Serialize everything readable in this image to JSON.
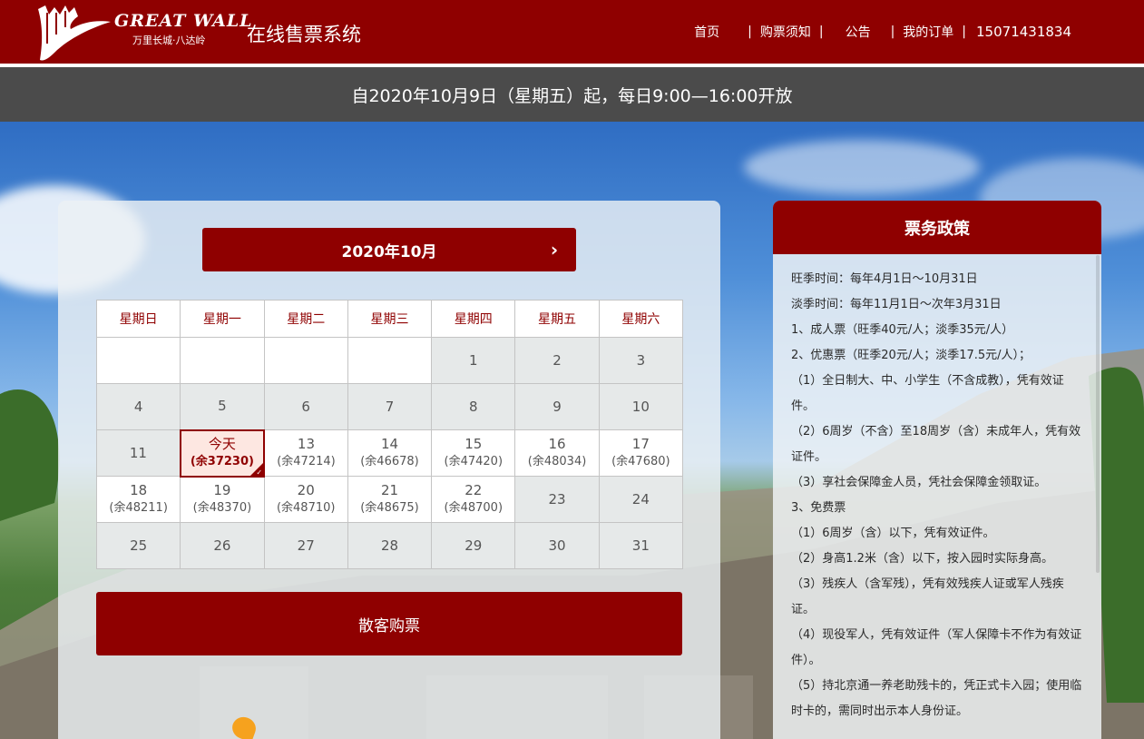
{
  "header": {
    "logo_en": "GREAT WALL",
    "logo_cn": "万里长城·八达岭",
    "site_title": "在线售票系统",
    "nav": {
      "home": "首页",
      "notice": "购票须知",
      "announcement": "公告",
      "orders": "我的订单",
      "phone": "15071431834",
      "separator": "|"
    }
  },
  "notice_bar": {
    "text": "自2020年10月9日（星期五）起，每日9:00—16:00开放"
  },
  "calendar": {
    "month_label": "2020年10月",
    "next_icon": "›",
    "weekdays": [
      "星期日",
      "星期一",
      "星期二",
      "星期三",
      "星期四",
      "星期五",
      "星期六"
    ],
    "weeks": [
      [
        {
          "day": "",
          "remain": "",
          "state": "empty"
        },
        {
          "day": "",
          "remain": "",
          "state": "empty"
        },
        {
          "day": "",
          "remain": "",
          "state": "empty"
        },
        {
          "day": "",
          "remain": "",
          "state": "empty"
        },
        {
          "day": "1",
          "remain": "",
          "state": "past"
        },
        {
          "day": "2",
          "remain": "",
          "state": "past"
        },
        {
          "day": "3",
          "remain": "",
          "state": "past"
        }
      ],
      [
        {
          "day": "4",
          "remain": "",
          "state": "past"
        },
        {
          "day": "5",
          "remain": "",
          "state": "past"
        },
        {
          "day": "6",
          "remain": "",
          "state": "past"
        },
        {
          "day": "7",
          "remain": "",
          "state": "past"
        },
        {
          "day": "8",
          "remain": "",
          "state": "past"
        },
        {
          "day": "9",
          "remain": "",
          "state": "past"
        },
        {
          "day": "10",
          "remain": "",
          "state": "past"
        }
      ],
      [
        {
          "day": "11",
          "remain": "",
          "state": "past"
        },
        {
          "day": "今天",
          "remain": "(余37230)",
          "state": "today"
        },
        {
          "day": "13",
          "remain": "(余47214)",
          "state": "avail"
        },
        {
          "day": "14",
          "remain": "(余46678)",
          "state": "avail"
        },
        {
          "day": "15",
          "remain": "(余47420)",
          "state": "avail"
        },
        {
          "day": "16",
          "remain": "(余48034)",
          "state": "avail"
        },
        {
          "day": "17",
          "remain": "(余47680)",
          "state": "avail"
        }
      ],
      [
        {
          "day": "18",
          "remain": "(余48211)",
          "state": "avail"
        },
        {
          "day": "19",
          "remain": "(余48370)",
          "state": "avail"
        },
        {
          "day": "20",
          "remain": "(余48710)",
          "state": "avail"
        },
        {
          "day": "21",
          "remain": "(余48675)",
          "state": "avail"
        },
        {
          "day": "22",
          "remain": "(余48700)",
          "state": "avail"
        },
        {
          "day": "23",
          "remain": "",
          "state": "past"
        },
        {
          "day": "24",
          "remain": "",
          "state": "past"
        }
      ],
      [
        {
          "day": "25",
          "remain": "",
          "state": "past"
        },
        {
          "day": "26",
          "remain": "",
          "state": "past"
        },
        {
          "day": "27",
          "remain": "",
          "state": "past"
        },
        {
          "day": "28",
          "remain": "",
          "state": "past"
        },
        {
          "day": "29",
          "remain": "",
          "state": "past"
        },
        {
          "day": "30",
          "remain": "",
          "state": "past"
        },
        {
          "day": "31",
          "remain": "",
          "state": "past"
        }
      ]
    ],
    "buy_button": "散客购票"
  },
  "policy": {
    "title": "票务政策",
    "lines": [
      "旺季时间：每年4月1日～10月31日",
      "淡季时间：每年11月1日～次年3月31日",
      "1、成人票（旺季40元/人；淡季35元/人）",
      "2、优惠票（旺季20元/人；淡季17.5元/人）；",
      "（1）全日制大、中、小学生（不含成教），凭有效证件。",
      "（2）6周岁（不含）至18周岁（含）未成年人，凭有效证件。",
      "（3）享社会保障金人员，凭社会保障金领取证。",
      "3、免费票",
      "（1）6周岁（含）以下，凭有效证件。",
      "（2）身高1.2米（含）以下，按入园时实际身高。",
      "（3）残疾人（含军残），凭有效残疾人证或军人残疾证。",
      "（4）现役军人，凭有效证件（军人保障卡不作为有效证件）。",
      "（5）持北京通一养老助残卡的，凭正式卡入园；使用临时卡的，需同时出示本人身份证。"
    ]
  },
  "colors": {
    "brand_red": "#8f0000",
    "bar_gray": "#4b4b4b"
  }
}
